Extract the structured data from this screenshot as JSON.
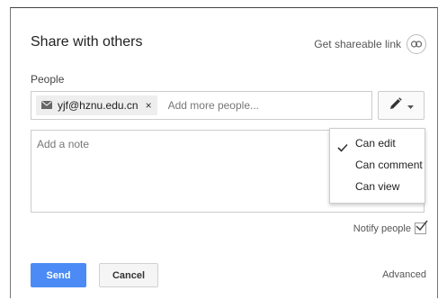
{
  "dialog": {
    "title": "Share with others",
    "get_link_label": "Get shareable link"
  },
  "people": {
    "label": "People",
    "chip_email": "yjf@hznu.edu.cn",
    "chip_remove": "×",
    "input_placeholder": "Add more people..."
  },
  "note": {
    "placeholder": "Add a note"
  },
  "permissions_menu": {
    "items": [
      {
        "label": "Can edit",
        "checked": true
      },
      {
        "label": "Can comment",
        "checked": false
      },
      {
        "label": "Can view",
        "checked": false
      }
    ]
  },
  "notify": {
    "label": "Notify people",
    "checked": true
  },
  "footer": {
    "send_label": "Send",
    "cancel_label": "Cancel",
    "advanced_label": "Advanced"
  },
  "colors": {
    "primary": "#4c8bf5"
  },
  "icons": {
    "link": "link-icon",
    "mail": "mail-icon",
    "pencil": "pencil-icon",
    "caret": "caret-down-icon",
    "check": "check-icon"
  }
}
